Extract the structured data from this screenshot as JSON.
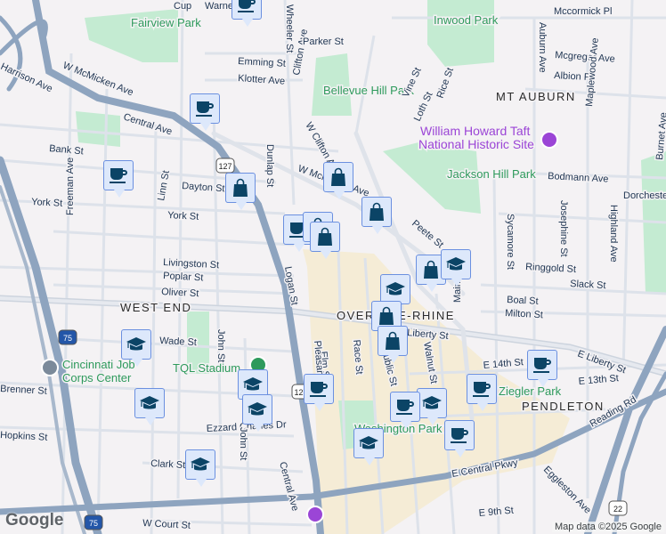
{
  "map": {
    "labels": [
      "Fairview Park",
      "Inwood Park",
      "Bellevue Hill Park",
      "Jackson Hill Park",
      "MT AUBURN",
      "WEST END",
      "OVER-THE-RHINE",
      "PENDLETON",
      "William Howard Taft",
      "National Historic Site",
      "TQL Stadium",
      "Cincinnati Job",
      "Corps Center",
      "Washington Park",
      "Ziegler Park",
      "W McMicken Ave",
      "Harrison Ave",
      "Central Ave",
      "Bank St",
      "Freeman Ave",
      "Linn St",
      "Dayton St",
      "York St",
      "York St",
      "Dunlap St",
      "Emming St",
      "Klotter Ave",
      "Clifton Ave",
      "Parker St",
      "Wheeler St",
      "Mccormick Pl",
      "Mcgregor Ave",
      "Albion Pl",
      "Auburn Ave",
      "Maplewood Ave",
      "Vine St",
      "Loth St",
      "Rice St",
      "Bodmann Ave",
      "Dorchester Ave",
      "Highland Ave",
      "Burnet Ave",
      "Josephine St",
      "Sycamore St",
      "Peete St",
      "Ringgold St",
      "Slack St",
      "Boal St",
      "Milton St",
      "Livingston St",
      "Poplar St",
      "Oliver St",
      "Wade St",
      "Logan St",
      "Elm St",
      "Pleasant St",
      "Race St",
      "Republic St",
      "Walnut St",
      "Main St",
      "E Liberty St",
      "Liberty St",
      "E 14th St",
      "E 13th St",
      "Reading Rd",
      "Ezzard Charles Dr",
      "John St",
      "John St",
      "Clark St",
      "Central Ave",
      "W Court St",
      "E Central Pkwy",
      "Eggleston Ave",
      "E 9th St",
      "Hopkins St",
      "Brenner St",
      "W Clifton Ave",
      "W McMicken Ave",
      "Warner St",
      "Cup"
    ],
    "markers": [
      "coffee",
      "coffee",
      "coffee",
      "bag",
      "bag",
      "bag",
      "coffee",
      "bag",
      "bag",
      "bag",
      "grad",
      "grad",
      "bag",
      "bag",
      "grad",
      "grad",
      "grad",
      "grad",
      "coffee",
      "coffee",
      "coffee",
      "grad",
      "coffee",
      "grad",
      "coffee",
      "grad"
    ],
    "shields": [
      "127",
      "127",
      "75",
      "75",
      "22"
    ]
  },
  "footer": {
    "logo": "Google",
    "attribution": "Map data ©2025 Google"
  },
  "colors": {
    "marker_bg": "#dde8fb",
    "marker_icon": "#0b4466",
    "highway": "#8ea4bf",
    "park": "#c4ebd2"
  }
}
